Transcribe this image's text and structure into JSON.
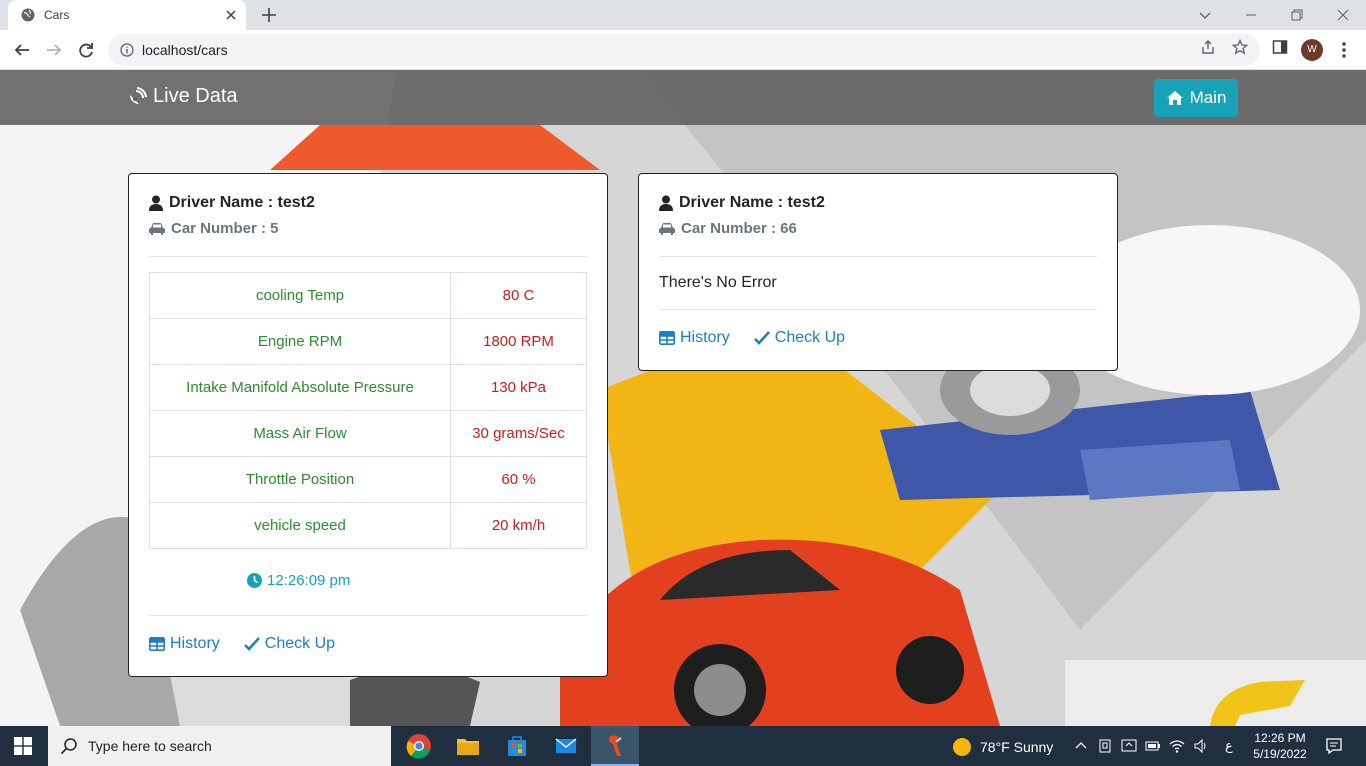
{
  "browser": {
    "tab_title": "Cars",
    "url": "localhost/cars",
    "profile_initial": "W"
  },
  "navbar": {
    "brand": "Live Data",
    "main_button": "Main"
  },
  "cards": [
    {
      "driver": "Driver Name : test2",
      "car_number": "Car Number : 5",
      "readings": [
        {
          "label": "cooling Temp",
          "value": "80 C"
        },
        {
          "label": "Engine RPM",
          "value": "1800 RPM"
        },
        {
          "label": "Intake Manifold Absolute Pressure",
          "value": "130 kPa"
        },
        {
          "label": "Mass Air Flow",
          "value": "30 grams/Sec"
        },
        {
          "label": "Throttle Position",
          "value": "60 %"
        },
        {
          "label": "vehicle speed",
          "value": "20 km/h"
        }
      ],
      "time": "12:26:09 pm",
      "history_label": "History",
      "checkup_label": "Check Up"
    },
    {
      "driver": "Driver Name : test2",
      "car_number": "Car Number : 66",
      "message": "There's No Error",
      "history_label": "History",
      "checkup_label": "Check Up"
    }
  ],
  "taskbar": {
    "search_placeholder": "Type here to search",
    "weather": "78°F  Sunny",
    "lang": "ع",
    "time": "12:26 PM",
    "date": "5/19/2022"
  },
  "colors": {
    "accent": "#17a2b8",
    "link": "#1f7ec1",
    "reading_label": "#2e8b2e",
    "reading_value": "#c81e1e"
  }
}
